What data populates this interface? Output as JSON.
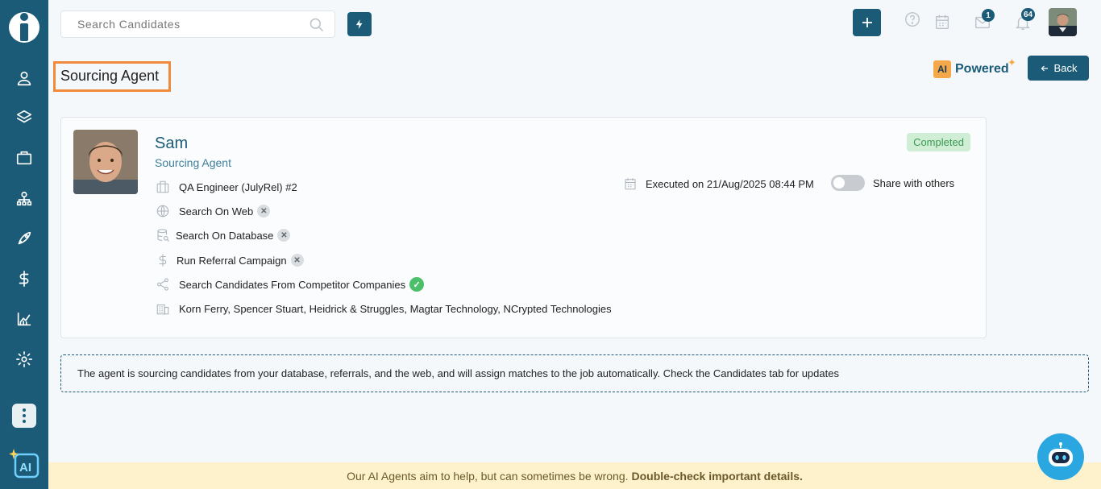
{
  "search": {
    "placeholder": "Search Candidates"
  },
  "topbar": {
    "mail_count": "1",
    "notification_count": "64"
  },
  "page": {
    "title": "Sourcing Agent",
    "ai_badge": "AI",
    "ai_label": "Powered",
    "back_label": "Back"
  },
  "agent": {
    "name": "Sam",
    "role": "Sourcing Agent",
    "status": "Completed",
    "executed": "Executed on 21/Aug/2025 08:44 PM",
    "share_label": "Share with others",
    "share_enabled": false,
    "rows": [
      {
        "icon": "briefcase-icon",
        "text": "QA Engineer (JulyRel) #2"
      },
      {
        "icon": "globe-icon",
        "text": "Search On Web",
        "state": "excluded"
      },
      {
        "icon": "database-icon",
        "text": "Search On Database",
        "state": "excluded"
      },
      {
        "icon": "dollar-icon",
        "text": "Run Referral Campaign",
        "state": "excluded"
      },
      {
        "icon": "share-icon",
        "text": "Search Candidates From Competitor Companies",
        "state": "included"
      },
      {
        "icon": "building-icon",
        "text": "Korn Ferry, Spencer Stuart, Heidrick & Struggles, Magtar Technology, NCrypted Technologies"
      }
    ]
  },
  "info_message": "The agent is sourcing candidates from your database, referrals, and the web, and will assign matches to the job automatically. Check the Candidates tab for updates",
  "footer": {
    "text": "Our AI Agents aim to help, but can sometimes be wrong.",
    "emphasis": "Double-check important details."
  },
  "colors": {
    "sidebar": "#1b5b77",
    "accent": "#1b5b77",
    "status_completed": "#3b9a52",
    "title_highlight": "#f08a3c"
  }
}
